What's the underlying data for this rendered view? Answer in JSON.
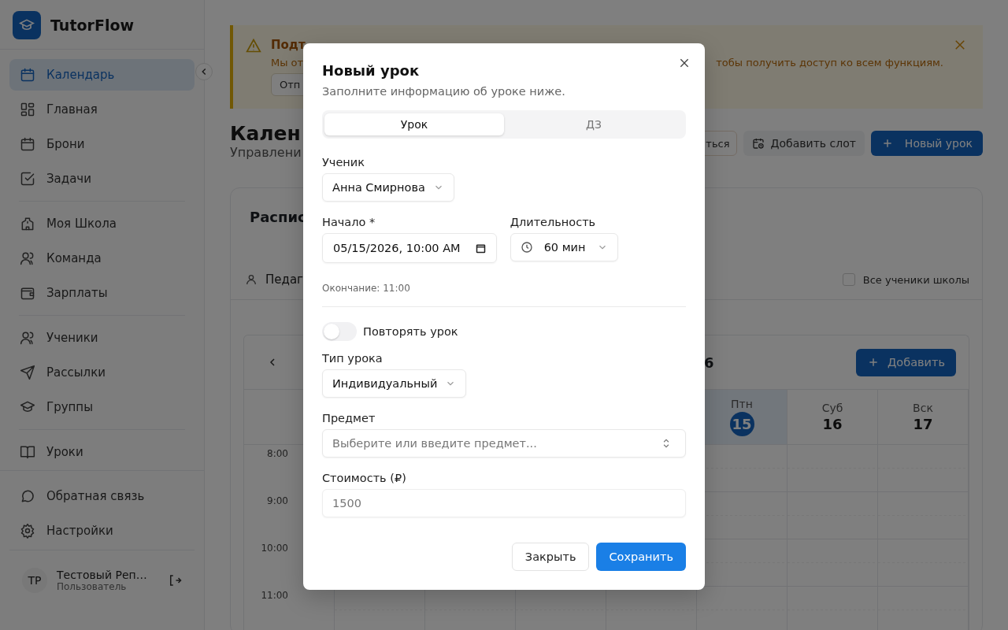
{
  "sidebar": {
    "app_name": "TutorFlow",
    "groups": [
      [
        {
          "label": "Календарь",
          "selected": true
        },
        {
          "label": "Главная",
          "selected": false
        },
        {
          "label": "Брони",
          "selected": false
        },
        {
          "label": "Задачи",
          "selected": false
        }
      ],
      [
        {
          "label": "Моя Школа",
          "selected": false
        },
        {
          "label": "Команда",
          "selected": false
        },
        {
          "label": "Зарплаты",
          "selected": false
        }
      ],
      [
        {
          "label": "Ученики",
          "selected": false
        },
        {
          "label": "Рассылки",
          "selected": false
        },
        {
          "label": "Группы",
          "selected": false
        }
      ],
      [
        {
          "label": "Уроки",
          "selected": false
        }
      ],
      [
        {
          "label": "Обратная связь",
          "selected": false
        },
        {
          "label": "Настройки",
          "selected": false
        }
      ]
    ],
    "user": {
      "initials": "ТР",
      "name": "Тестовый Реп…",
      "role": "Пользователь"
    }
  },
  "banner": {
    "title": "Подт",
    "text_start": "Мы от",
    "text_end": "тобы получить доступ ко всем функциям.",
    "button": "Отп"
  },
  "page": {
    "title": "Кален",
    "subtitle": "Управлени",
    "actions": [
      {
        "label": "ться",
        "kind": "outline"
      },
      {
        "label": "Добавить слот",
        "kind": "secondary"
      },
      {
        "label": "Новый урок",
        "kind": "primary"
      }
    ]
  },
  "schedule": {
    "title": "Распис",
    "teacher_filter": "Педаг",
    "all_students": {
      "label": "Все ученики школы",
      "checked": false
    },
    "calendar": {
      "title_end": "6",
      "add_button": "Добавить",
      "days": [
        {
          "name": "Птн",
          "date": "15",
          "today": true
        },
        {
          "name": "Суб",
          "date": "16",
          "today": false
        },
        {
          "name": "Вск",
          "date": "17",
          "today": false
        }
      ],
      "times": [
        "8:00",
        "9:00",
        "10:00",
        "11:00"
      ]
    }
  },
  "dialog": {
    "title": "Новый урок",
    "subtitle": "Заполните информацию об уроке ниже.",
    "tabs": [
      {
        "label": "Урок",
        "selected": true
      },
      {
        "label": "ДЗ",
        "selected": false
      }
    ],
    "student": {
      "label": "Ученик",
      "value": "Анна Смирнова"
    },
    "start": {
      "label": "Начало *",
      "value": "05/15/2026, 10:00 AM"
    },
    "duration": {
      "label": "Длительность",
      "value": "60 мин"
    },
    "end_note": "Окончание: 11:00",
    "repeat": {
      "label": "Повторять урок",
      "on": false
    },
    "lesson_type": {
      "label": "Тип урока",
      "value": "Индивидуальный"
    },
    "subject": {
      "label": "Предмет",
      "placeholder": "Выберите или введите предмет..."
    },
    "price": {
      "label": "Стоимость (₽)",
      "placeholder": "1500"
    },
    "buttons": {
      "cancel": "Закрыть",
      "save": "Сохранить"
    }
  }
}
